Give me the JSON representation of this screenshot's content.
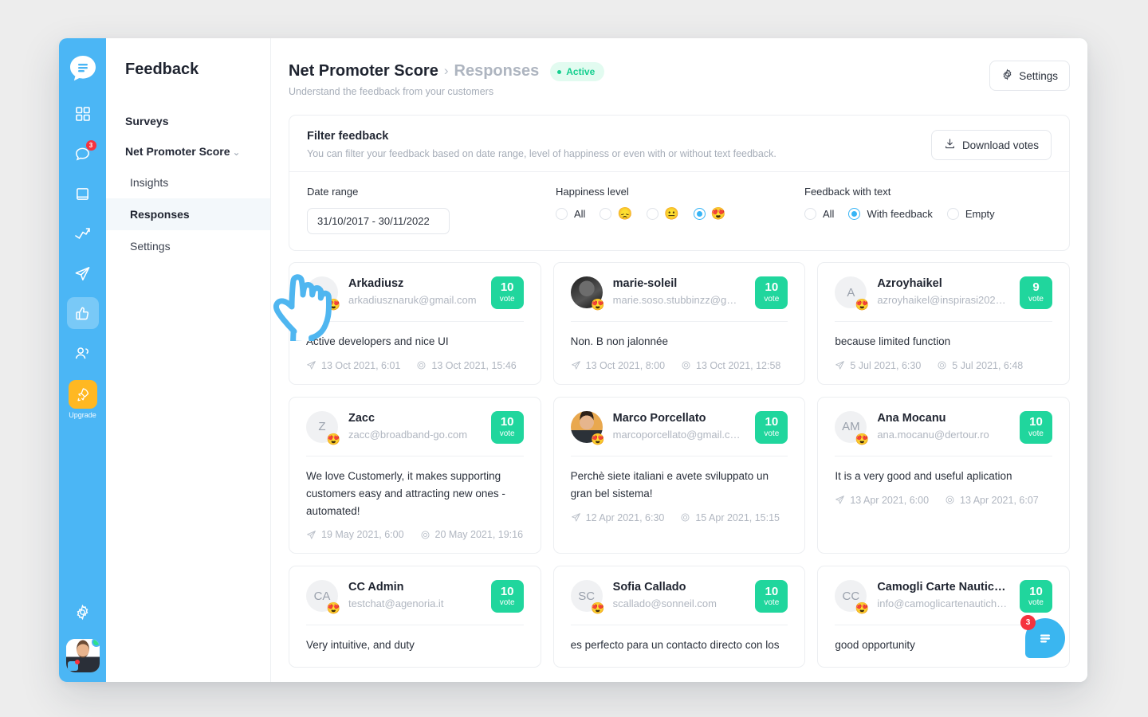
{
  "rail": {
    "logo_icon": "chat-logo-icon",
    "items": [
      {
        "icon": "grid-icon",
        "name": "dashboard",
        "badge": "",
        "active": false
      },
      {
        "icon": "chat-icon",
        "name": "conversations",
        "badge": "3",
        "active": false
      },
      {
        "icon": "book-icon",
        "name": "knowledge-base",
        "badge": "",
        "active": false
      },
      {
        "icon": "trend-icon",
        "name": "analytics",
        "badge": "",
        "active": false
      },
      {
        "icon": "paper-plane-icon",
        "name": "campaigns",
        "badge": "",
        "active": false
      },
      {
        "icon": "thumbs-up-icon",
        "name": "feedback",
        "badge": "",
        "active": true
      },
      {
        "icon": "people-icon",
        "name": "contacts",
        "badge": "",
        "active": false
      }
    ],
    "upgrade": {
      "label": "Upgrade",
      "icon": "rocket-icon",
      "color": "#ffb822"
    },
    "settings_icon": "gear-icon",
    "avatar": "user-avatar"
  },
  "sidebar": {
    "title": "Feedback",
    "items": [
      {
        "label": "Surveys",
        "level": "top",
        "selected": false,
        "chevron": ""
      },
      {
        "label": "Net Promoter Score",
        "level": "top",
        "selected": false,
        "chevron": "⌄"
      },
      {
        "label": "Insights",
        "level": "sub",
        "selected": false
      },
      {
        "label": "Responses",
        "level": "sub",
        "selected": true
      },
      {
        "label": "Settings",
        "level": "sub",
        "selected": false
      }
    ]
  },
  "header": {
    "breadcrumb_root": "Net Promoter Score",
    "breadcrumb_sep": "›",
    "breadcrumb_current": "Responses",
    "status": "Active",
    "status_color": "#15cf8f",
    "subtitle": "Understand the feedback from your customers",
    "settings_label": "Settings",
    "settings_icon": "gear-icon"
  },
  "filter": {
    "title": "Filter feedback",
    "description": "You can filter your feedback based on date range, level of happiness or even with or without text feedback.",
    "download_label": "Download votes",
    "download_icon": "download-icon",
    "date_label": "Date range",
    "date_value": "31/10/2017 - 30/11/2022",
    "happiness_label": "Happiness level",
    "happiness_options": [
      {
        "text": "All",
        "emoji": "",
        "selected": false
      },
      {
        "text": "",
        "emoji": "😞",
        "selected": false
      },
      {
        "text": "",
        "emoji": "😐",
        "selected": false
      },
      {
        "text": "",
        "emoji": "😍",
        "selected": true
      }
    ],
    "text_label": "Feedback with text",
    "text_options": [
      {
        "text": "All",
        "selected": false
      },
      {
        "text": "With feedback",
        "selected": true
      },
      {
        "text": "Empty",
        "selected": false
      }
    ]
  },
  "vote_label": "vote",
  "responses": [
    {
      "initials": "A",
      "photo": false,
      "name": "Arkadiusz",
      "email": "arkadiusznaruk@gmail.com",
      "emoji": "😍",
      "score": "10",
      "text": "Active developers and nice UI",
      "sent": "13 Oct 2021, 6:01",
      "answered": "13 Oct 2021, 15:46"
    },
    {
      "initials": "",
      "photo": "dark",
      "name": "marie-soleil",
      "email": "marie.soso.stubbinzz@g…",
      "emoji": "😍",
      "score": "10",
      "text": "Non. B non jalonnée",
      "sent": "13 Oct 2021, 8:00",
      "answered": "13 Oct 2021, 12:58"
    },
    {
      "initials": "A",
      "photo": false,
      "name": "Azroyhaikel",
      "email": "azroyhaikel@inspirasi202…",
      "emoji": "😍",
      "score": "9",
      "text": "because limited function",
      "sent": "5 Jul 2021, 6:30",
      "answered": "5 Jul 2021, 6:48"
    },
    {
      "initials": "Z",
      "photo": false,
      "name": "Zacc",
      "email": "zacc@broadband-go.com",
      "emoji": "😍",
      "score": "10",
      "text": "We love Customerly, it makes supporting customers easy and attracting new ones - automated!",
      "sent": "19 May 2021, 6:00",
      "answered": "20 May 2021, 19:16"
    },
    {
      "initials": "",
      "photo": "man",
      "name": "Marco Porcellato",
      "email": "marcoporcellato@gmail.c…",
      "emoji": "😍",
      "score": "10",
      "text": "Perchè siete italiani e avete sviluppato un gran bel sistema!",
      "sent": "12 Apr 2021, 6:30",
      "answered": "15 Apr 2021, 15:15"
    },
    {
      "initials": "AM",
      "photo": false,
      "name": "Ana Mocanu",
      "email": "ana.mocanu@dertour.ro",
      "emoji": "😍",
      "score": "10",
      "text": "It is a very good and useful aplication",
      "sent": "13 Apr 2021, 6:00",
      "answered": "13 Apr 2021, 6:07"
    },
    {
      "initials": "CA",
      "photo": false,
      "name": "CC Admin",
      "email": "testchat@agenoria.it",
      "emoji": "😍",
      "score": "10",
      "text": "Very intuitive, and duty",
      "sent": "",
      "answered": ""
    },
    {
      "initials": "SC",
      "photo": false,
      "name": "Sofia Callado",
      "email": "scallado@sonneil.com",
      "emoji": "😍",
      "score": "10",
      "text": "es perfecto para un contacto directo con los",
      "sent": "",
      "answered": ""
    },
    {
      "initials": "CC",
      "photo": false,
      "name": "Camogli Carte Nautic…",
      "email": "info@camoglicartenautich…",
      "emoji": "😍",
      "score": "10",
      "text": "good opportunity",
      "sent": "",
      "answered": ""
    }
  ],
  "chat_widget": {
    "count": "3",
    "icon": "chat-icon"
  },
  "colors": {
    "accent_blue": "#4bb6f5",
    "vote_green": "#20d69d",
    "status_green": "#15cf8f",
    "upgrade_orange": "#ffb822",
    "badge_red": "#f5333f"
  }
}
